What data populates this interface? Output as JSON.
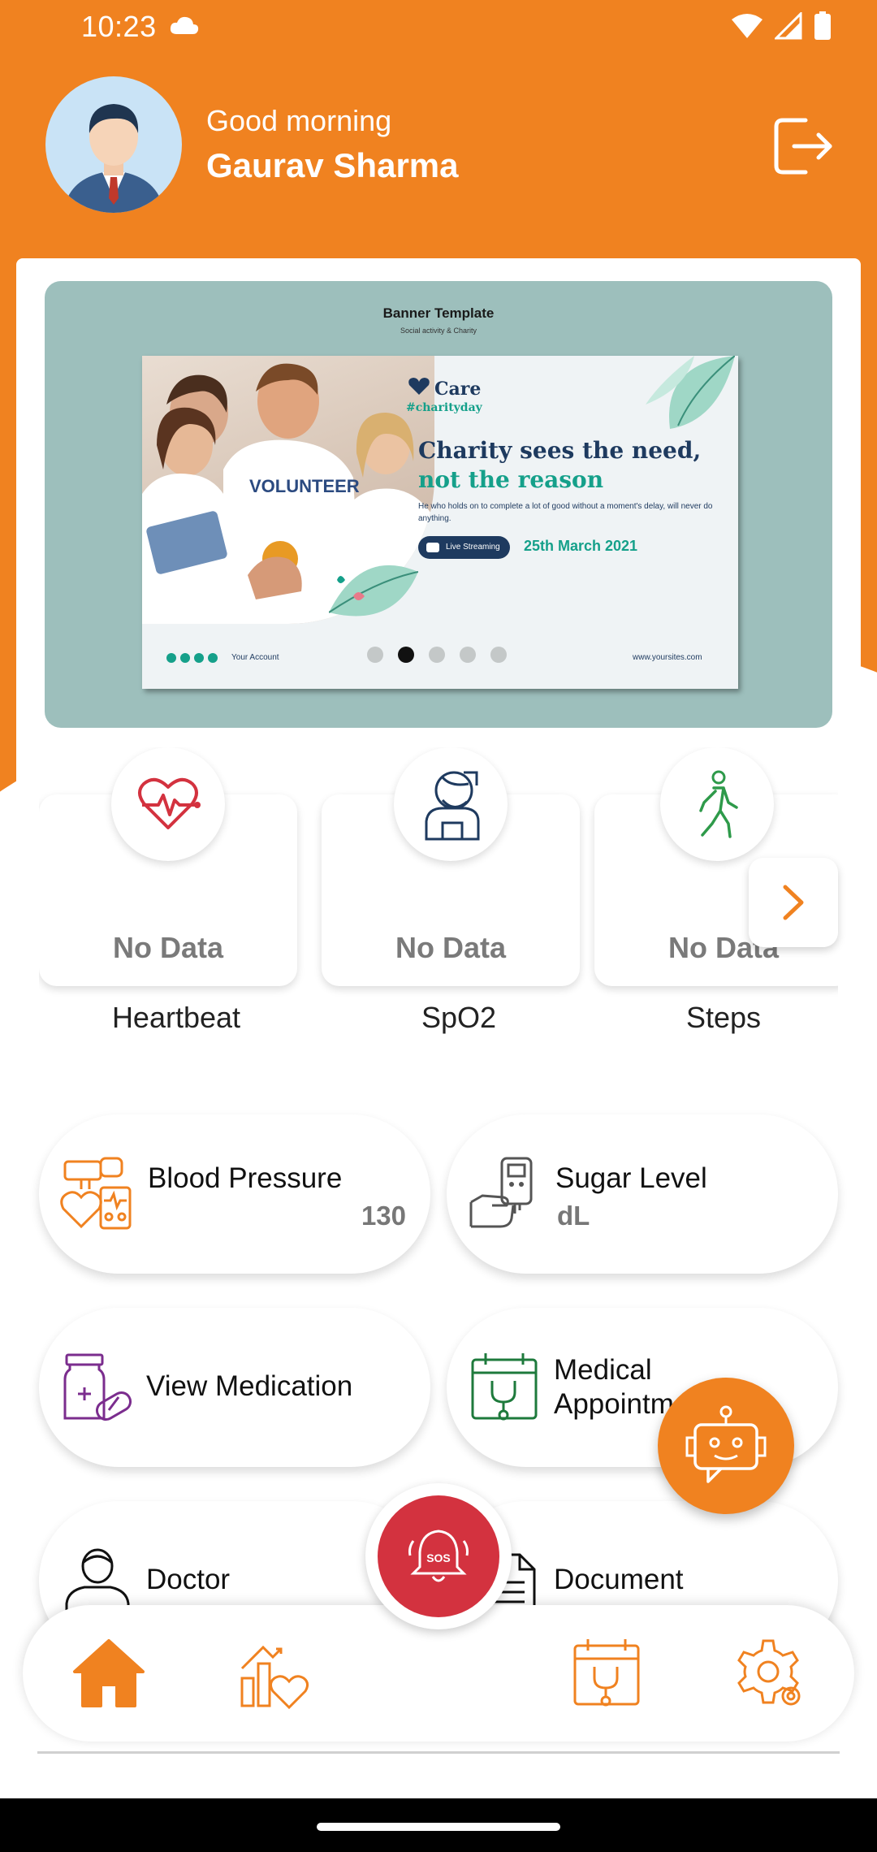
{
  "status_bar": {
    "time": "10:23"
  },
  "header": {
    "greeting": "Good morning",
    "user_name": "Gaurav Sharma"
  },
  "banner": {
    "title": "Banner Template",
    "subtitle": "Social activity & Charity",
    "brand": "Care",
    "hashtag": "#charityday",
    "headline_1": "Charity sees the need,",
    "headline_2": "not the reason",
    "body": "He who holds on to complete a lot of good without a moment's delay, will never do anything.",
    "live_label": "Live Streaming",
    "date": "25th March 2021",
    "account_label": "Your Account",
    "website": "www.yoursites.com",
    "slides_count": 5,
    "active_slide": 2
  },
  "vitals": [
    {
      "label": "Heartbeat",
      "value": "No Data",
      "icon": "heartbeat-icon"
    },
    {
      "label": "SpO2",
      "value": "No Data",
      "icon": "doctor-oxygen-icon"
    },
    {
      "label": "Steps",
      "value": "No Data",
      "icon": "walking-icon"
    }
  ],
  "features": {
    "blood_pressure": {
      "title": "Blood Pressure",
      "value": "130"
    },
    "sugar_level": {
      "title": "Sugar Level",
      "value": "dL"
    },
    "view_medication": {
      "title": "View Medication"
    },
    "medical_appointment": {
      "title_line1": "Medical",
      "title_line2": "Appointment"
    },
    "doctor": {
      "title": "Doctor"
    },
    "document": {
      "title": "Document"
    }
  },
  "sos": {
    "label": "SOS"
  },
  "colors": {
    "primary": "#F08220",
    "sos": "#D3323F",
    "purple": "#7B2D8E",
    "green": "#1E7A3C",
    "heart_red": "#D3323F"
  }
}
